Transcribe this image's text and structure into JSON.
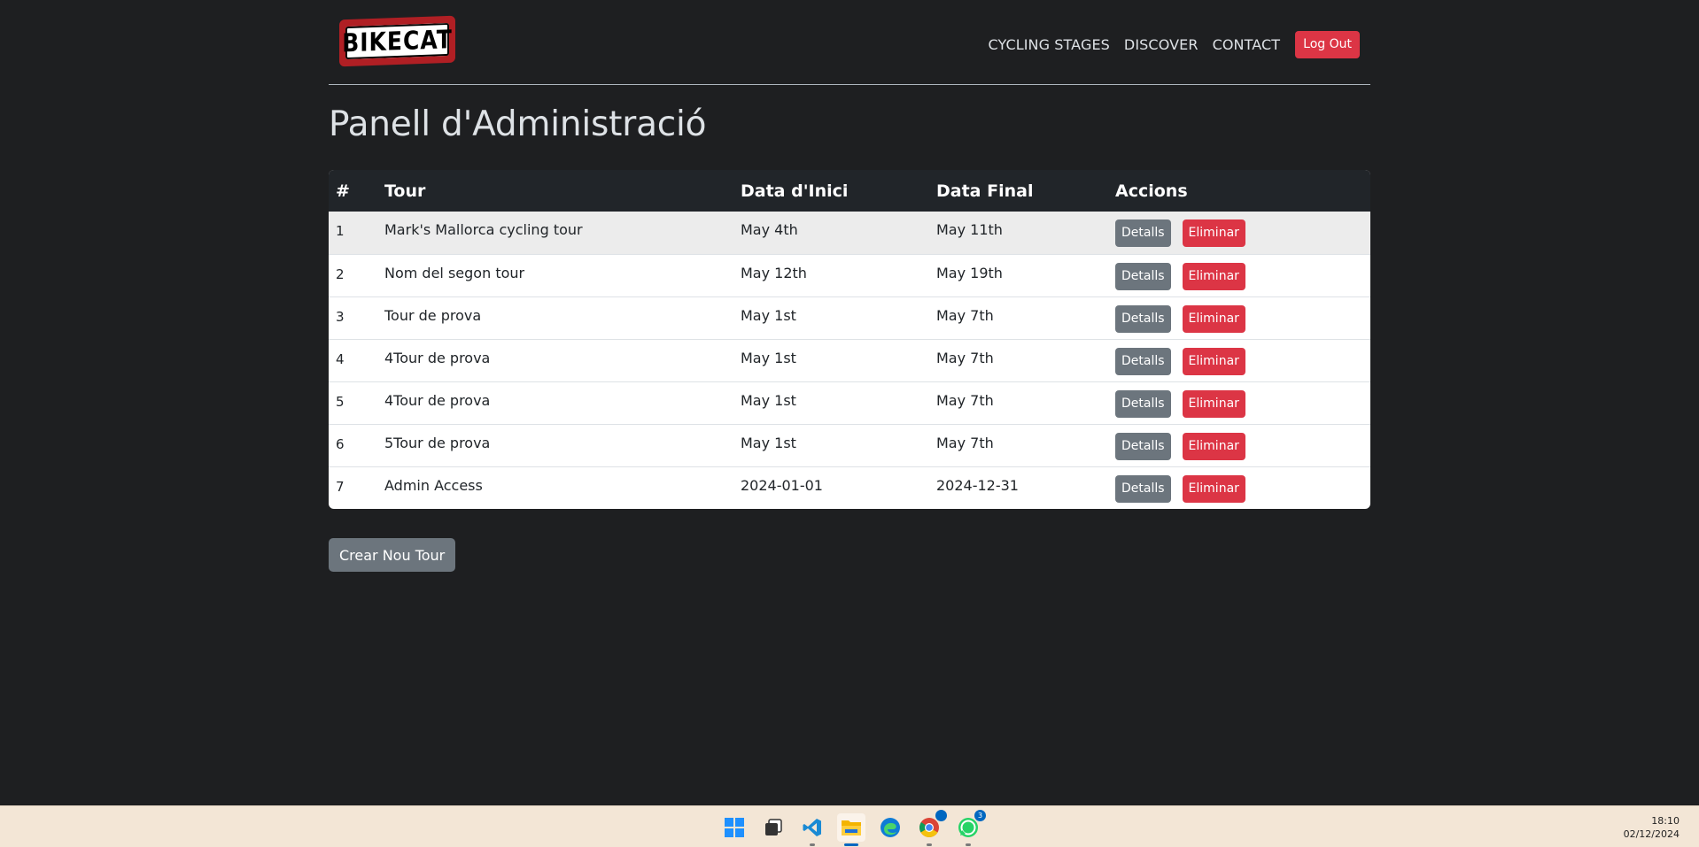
{
  "header": {
    "logo_text": "BIKECAT",
    "nav": [
      {
        "label": "CYCLING STAGES"
      },
      {
        "label": "DISCOVER"
      },
      {
        "label": "CONTACT"
      }
    ],
    "logout_label": "Log Out"
  },
  "page_title": "Panell d'Administració",
  "table": {
    "columns": [
      "#",
      "Tour",
      "Data d'Inici",
      "Data Final",
      "Accions"
    ],
    "rows": [
      {
        "num": "1",
        "tour": "Mark's Mallorca cycling tour",
        "start": "May 4th",
        "end": "May 11th"
      },
      {
        "num": "2",
        "tour": "Nom del segon tour",
        "start": "May 12th",
        "end": "May 19th"
      },
      {
        "num": "3",
        "tour": "Tour de prova",
        "start": "May 1st",
        "end": "May 7th"
      },
      {
        "num": "4",
        "tour": "4Tour de prova",
        "start": "May 1st",
        "end": "May 7th"
      },
      {
        "num": "5",
        "tour": "4Tour de prova",
        "start": "May 1st",
        "end": "May 7th"
      },
      {
        "num": "6",
        "tour": "5Tour de prova",
        "start": "May 1st",
        "end": "May 7th"
      },
      {
        "num": "7",
        "tour": "Admin Access",
        "start": "2024-01-01",
        "end": "2024-12-31"
      }
    ],
    "details_label": "Detalls",
    "delete_label": "Eliminar"
  },
  "create_label": "Crear Nou Tour",
  "taskbar": {
    "icons": [
      "windows-start-icon",
      "task-view-icon",
      "vscode-icon",
      "file-explorer-icon",
      "edge-icon",
      "chrome-icon",
      "whatsapp-icon"
    ],
    "chrome_badge": "",
    "whatsapp_badge": "3",
    "time": "18:10",
    "date": "02/12/2024"
  },
  "colors": {
    "background": "#1e1f21",
    "danger": "#dc3545",
    "secondary": "#6c757d",
    "table_header": "#212529",
    "taskbar": "#f3e6d6"
  }
}
